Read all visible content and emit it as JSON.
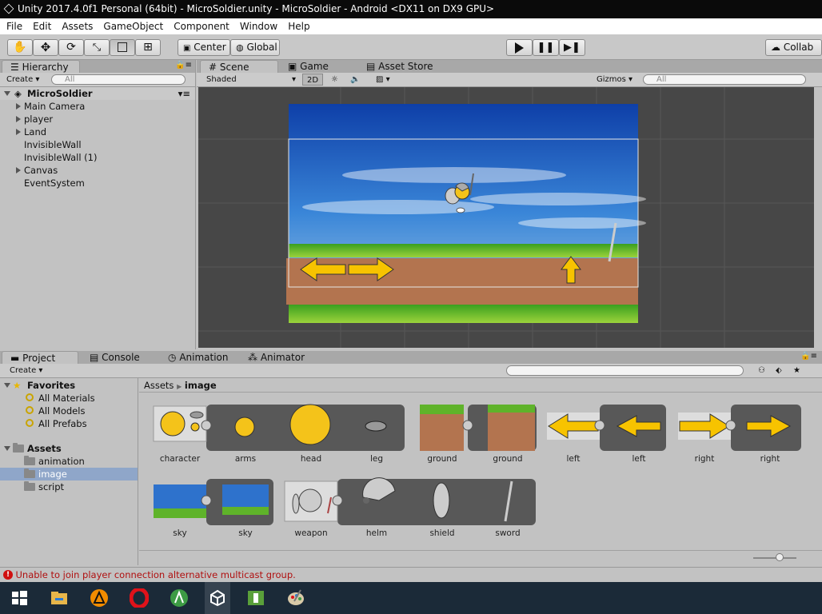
{
  "window": {
    "title": "Unity 2017.4.0f1 Personal (64bit) - MicroSoldier.unity - MicroSoldier - Android <DX11 on DX9 GPU>"
  },
  "menu": [
    "File",
    "Edit",
    "Assets",
    "GameObject",
    "Component",
    "Window",
    "Help"
  ],
  "toolbar": {
    "tools": [
      "hand-tool",
      "move-tool",
      "rotate-tool",
      "scale-tool",
      "rect-tool",
      "transform-tool"
    ],
    "pivot_label": "Center",
    "space_label": "Global",
    "collab_label": "Collab"
  },
  "hierarchy": {
    "tab": "Hierarchy",
    "create": "Create",
    "search_placeholder": "All",
    "scene": "MicroSoldier",
    "items": [
      {
        "label": "Main Camera",
        "expandable": true
      },
      {
        "label": "player",
        "expandable": true
      },
      {
        "label": "Land",
        "expandable": true
      },
      {
        "label": "InvisibleWall",
        "expandable": false
      },
      {
        "label": "InvisibleWall (1)",
        "expandable": false
      },
      {
        "label": "Canvas",
        "expandable": true
      },
      {
        "label": "EventSystem",
        "expandable": false
      }
    ]
  },
  "scene_view": {
    "tabs": [
      "Scene",
      "Game",
      "Asset Store"
    ],
    "shading": "Shaded",
    "mode_2d": "2D",
    "gizmos": "Gizmos",
    "search_placeholder": "All"
  },
  "bottom_tabs": [
    "Project",
    "Console",
    "Animation",
    "Animator"
  ],
  "project": {
    "create": "Create",
    "favorites_label": "Favorites",
    "favorites": [
      "All Materials",
      "All Models",
      "All Prefabs"
    ],
    "assets_label": "Assets",
    "folders": [
      "animation",
      "image",
      "script"
    ],
    "selected_folder": "image",
    "breadcrumb": [
      "Assets",
      "image"
    ],
    "assets_row1": [
      "character",
      "arms",
      "head",
      "leg",
      "ground",
      "ground",
      "left",
      "left",
      "right",
      "right"
    ],
    "assets_row2": [
      "sky",
      "sky",
      "weapon",
      "helm",
      "shield",
      "sword"
    ]
  },
  "status": {
    "message": "Unable to join player connection alternative multicast group.",
    "color": "#b01010"
  },
  "colors": {
    "arrow": "#f7c300",
    "ground": "#b3744f",
    "grass": "#5fb32a",
    "sky": "#2e72cc",
    "selection": "#3d7bd9"
  }
}
